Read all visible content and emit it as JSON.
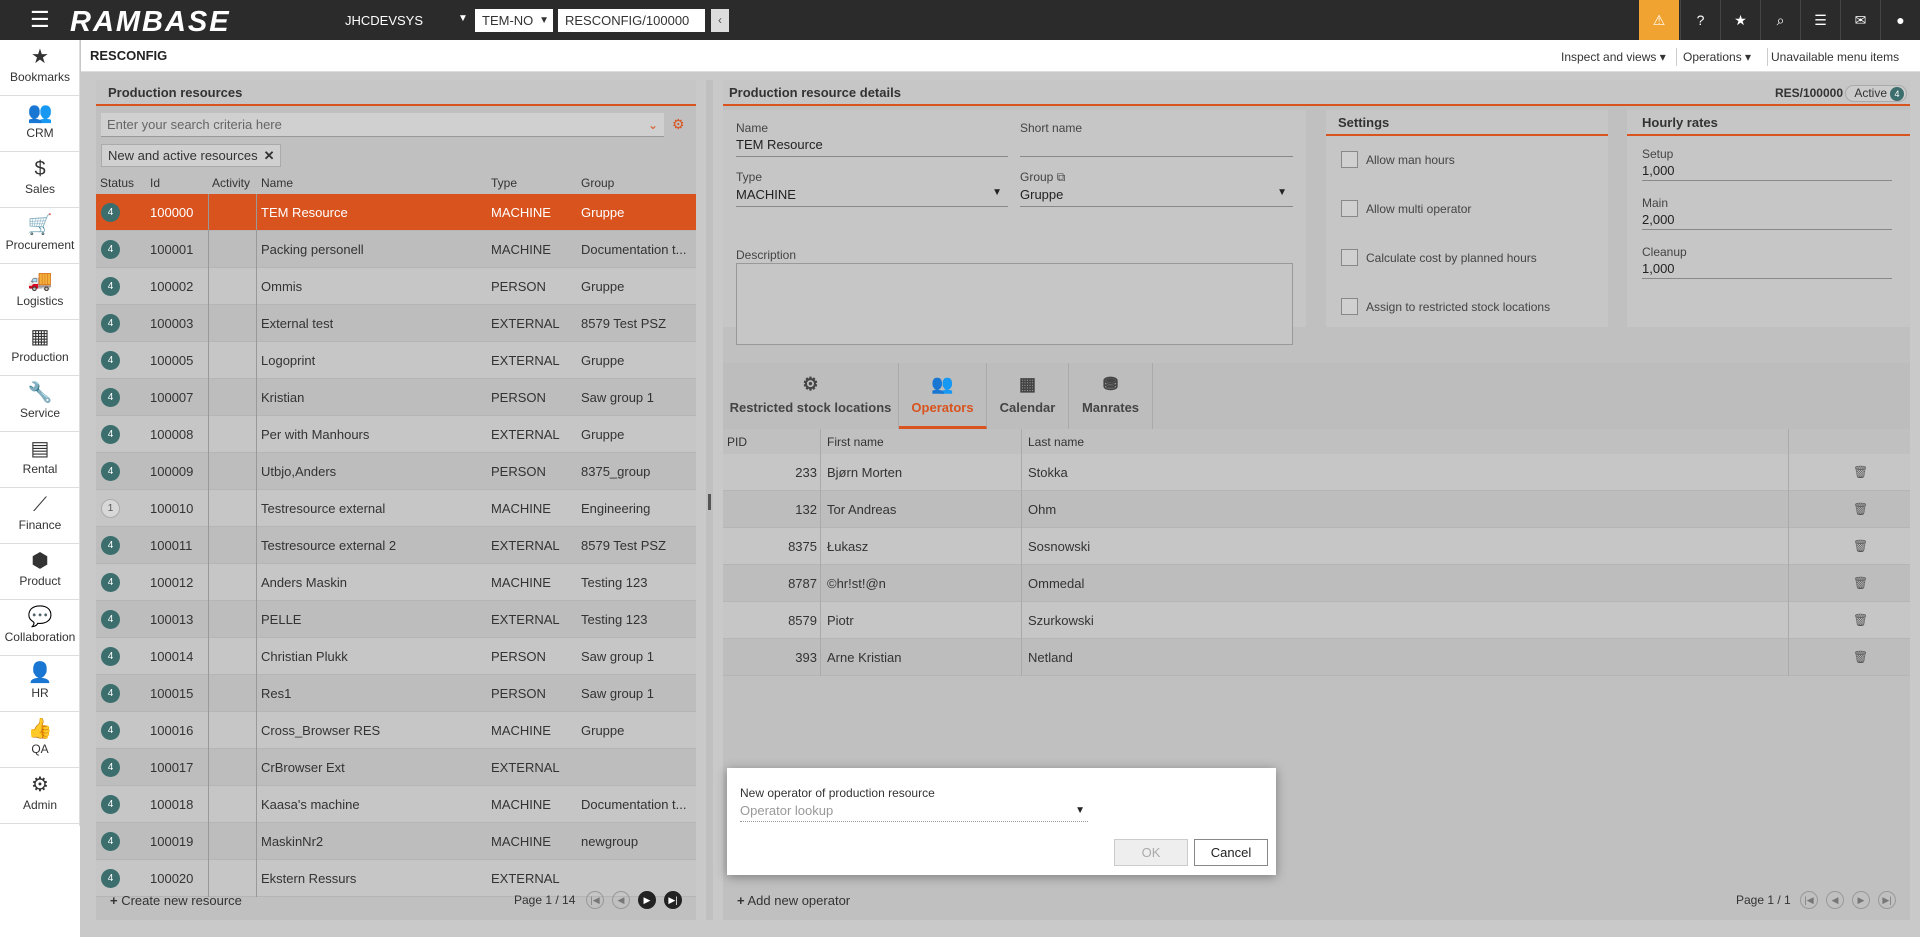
{
  "topbar": {
    "logo": "RAMBASE",
    "system": "JHCDEVSYS",
    "company": "TEM-NO",
    "path": "RESCONFIG/100000"
  },
  "nav": [
    {
      "label": "Bookmarks",
      "icon": "star-icon"
    },
    {
      "label": "CRM",
      "icon": "people-icon"
    },
    {
      "label": "Sales",
      "icon": "moneybag-icon"
    },
    {
      "label": "Procurement",
      "icon": "cart-icon"
    },
    {
      "label": "Logistics",
      "icon": "truck-icon"
    },
    {
      "label": "Production",
      "icon": "boxes-icon"
    },
    {
      "label": "Service",
      "icon": "wrench-icon"
    },
    {
      "label": "Rental",
      "icon": "rental-icon"
    },
    {
      "label": "Finance",
      "icon": "chart-line-icon"
    },
    {
      "label": "Product",
      "icon": "cube-icon"
    },
    {
      "label": "Collaboration",
      "icon": "chat-icon"
    },
    {
      "label": "HR",
      "icon": "person-icon"
    },
    {
      "label": "QA",
      "icon": "thumbs-up-icon"
    },
    {
      "label": "Admin",
      "icon": "gear-icon"
    }
  ],
  "header": {
    "title": "RESCONFIG",
    "menu_inspect": "Inspect and views ▾",
    "menu_operations": "Operations ▾",
    "menu_unavailable": "Unavailable menu items"
  },
  "list": {
    "title": "Production resources",
    "search_placeholder": "Enter your search criteria here",
    "filter_chip": "New and active resources",
    "columns": [
      "Status",
      "Id",
      "Activity",
      "Name",
      "Type",
      "Group"
    ],
    "rows": [
      {
        "status": "4",
        "id": "100000",
        "name": "TEM Resource",
        "type": "MACHINE",
        "group": "Gruppe"
      },
      {
        "status": "4",
        "id": "100001",
        "name": "Packing personell",
        "type": "MACHINE",
        "group": "Documentation t..."
      },
      {
        "status": "4",
        "id": "100002",
        "name": "Ommis",
        "type": "PERSON",
        "group": "Gruppe"
      },
      {
        "status": "4",
        "id": "100003",
        "name": "External test",
        "type": "EXTERNAL",
        "group": "8579 Test PSZ"
      },
      {
        "status": "4",
        "id": "100005",
        "name": "Logoprint",
        "type": "EXTERNAL",
        "group": "Gruppe"
      },
      {
        "status": "4",
        "id": "100007",
        "name": "Kristian",
        "type": "PERSON",
        "group": "Saw group 1"
      },
      {
        "status": "4",
        "id": "100008",
        "name": "Per with Manhours",
        "type": "EXTERNAL",
        "group": "Gruppe"
      },
      {
        "status": "4",
        "id": "100009",
        "name": "Utbjo,Anders",
        "type": "PERSON",
        "group": "8375_group"
      },
      {
        "status": "1",
        "id": "100010",
        "name": "Testresource external",
        "type": "MACHINE",
        "group": "Engineering"
      },
      {
        "status": "4",
        "id": "100011",
        "name": "Testresource external 2",
        "type": "EXTERNAL",
        "group": "8579 Test PSZ"
      },
      {
        "status": "4",
        "id": "100012",
        "name": "Anders Maskin",
        "type": "MACHINE",
        "group": "Testing 123"
      },
      {
        "status": "4",
        "id": "100013",
        "name": "PELLE",
        "type": "EXTERNAL",
        "group": "Testing 123"
      },
      {
        "status": "4",
        "id": "100014",
        "name": "Christian Plukk",
        "type": "PERSON",
        "group": "Saw group 1"
      },
      {
        "status": "4",
        "id": "100015",
        "name": "Res1",
        "type": "PERSON",
        "group": "Saw group 1"
      },
      {
        "status": "4",
        "id": "100016",
        "name": "Cross_Browser RES",
        "type": "MACHINE",
        "group": "Gruppe"
      },
      {
        "status": "4",
        "id": "100017",
        "name": "CrBrowser Ext",
        "type": "EXTERNAL",
        "group": ""
      },
      {
        "status": "4",
        "id": "100018",
        "name": "Kaasa's machine",
        "type": "MACHINE",
        "group": "Documentation t..."
      },
      {
        "status": "4",
        "id": "100019",
        "name": "MaskinNr2",
        "type": "MACHINE",
        "group": "newgroup"
      },
      {
        "status": "4",
        "id": "100020",
        "name": "Ekstern Ressurs",
        "type": "EXTERNAL",
        "group": ""
      }
    ],
    "create_label": "Create new resource",
    "page": "Page 1 / 14"
  },
  "details": {
    "title": "Production resource details",
    "res_id": "RES/100000",
    "status_label": "Active",
    "status_num": "4",
    "name_label": "Name",
    "name_value": "TEM Resource",
    "short_label": "Short name",
    "short_value": "",
    "type_label": "Type",
    "type_value": "MACHINE",
    "group_label": "Group",
    "group_value": "Gruppe",
    "desc_label": "Description",
    "settings_title": "Settings",
    "settings": [
      "Allow man hours",
      "Allow multi operator",
      "Calculate cost by planned hours",
      "Assign to restricted stock locations"
    ],
    "rates_title": "Hourly rates",
    "setup_label": "Setup",
    "setup_value": "1,000",
    "main_label": "Main",
    "main_value": "2,000",
    "cleanup_label": "Cleanup",
    "cleanup_value": "1,000"
  },
  "tabs": [
    {
      "label": "Restricted stock locations",
      "icon": "boxes-icon"
    },
    {
      "label": "Operators",
      "icon": "people-icon"
    },
    {
      "label": "Calendar",
      "icon": "calendar-icon"
    },
    {
      "label": "Manrates",
      "icon": "coins-icon"
    }
  ],
  "operators": {
    "columns": [
      "PID",
      "First name",
      "Last name"
    ],
    "rows": [
      {
        "pid": "233",
        "first": "Bjørn Morten",
        "last": "Stokka"
      },
      {
        "pid": "132",
        "first": "Tor Andreas",
        "last": "Ohm"
      },
      {
        "pid": "8375",
        "first": "Łukasz",
        "last": "Sosnowski"
      },
      {
        "pid": "8787",
        "first": "©hr!st!@n",
        "last": "Ommedal"
      },
      {
        "pid": "8579",
        "first": "Piotr",
        "last": "Szurkowski"
      },
      {
        "pid": "393",
        "first": "Arne Kristian",
        "last": "Netland"
      }
    ],
    "add_label": "Add new operator",
    "page": "Page 1 / 1"
  },
  "dialog": {
    "label": "New operator of production resource",
    "placeholder": "Operator lookup",
    "ok": "OK",
    "cancel": "Cancel"
  }
}
